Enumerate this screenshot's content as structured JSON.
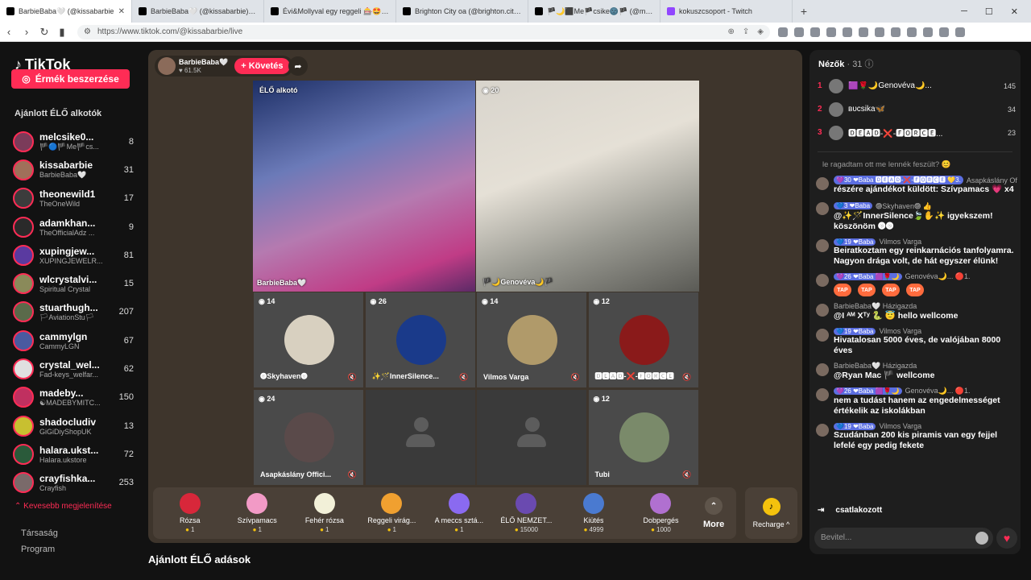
{
  "browser": {
    "tabs": [
      {
        "title": "BarbieBaba🤍 (@kissabarbie"
      },
      {
        "title": "BarbieBaba🤍 (@kissabarbie) ÉLŐ"
      },
      {
        "title": "Évi&Mollyval egy reggeli 🎰🤩 (@m"
      },
      {
        "title": "Brighton City oa (@brighton.city) ÉLŐ"
      },
      {
        "title": "🏴🌙⬛Me🏴csike🌚🏴 (@melc"
      },
      {
        "title": "kokuszcsoport - Twitch"
      }
    ],
    "url": "https://www.tiktok.com/@kissabarbie/live"
  },
  "sidebar": {
    "logo": "TikTok",
    "coins_button": "Érmék beszerzése",
    "section_title": "Ajánlott ÉLŐ alkotók",
    "creators": [
      {
        "name": "melcsike0...",
        "sub": "🏴🔵🏴Me🏴cs...",
        "count": "8",
        "color": "#7b3b5a"
      },
      {
        "name": "kissabarbie",
        "sub": "BarbieBaba🤍",
        "count": "31",
        "color": "#a0705a"
      },
      {
        "name": "theonewild1",
        "sub": "TheOneWild",
        "count": "17",
        "color": "#3c3c3c"
      },
      {
        "name": "adamkhan...",
        "sub": "TheOfficialAdz ...",
        "count": "9",
        "color": "#2a2a2a"
      },
      {
        "name": "xupingjew...",
        "sub": "XUPINGJEWELR...",
        "count": "81",
        "color": "#5a3aa0"
      },
      {
        "name": "wlcrystalvi...",
        "sub": "Spiritual Crystal",
        "count": "15",
        "color": "#8a8a5a"
      },
      {
        "name": "stuarthugh...",
        "sub": "🏳AviationStu🏳",
        "count": "207",
        "color": "#5a6a4a"
      },
      {
        "name": "cammylgn",
        "sub": "CammyLGN",
        "count": "67",
        "color": "#4a5aa0"
      },
      {
        "name": "crystal_wel...",
        "sub": "Fad-keys_welfar...",
        "count": "62",
        "color": "#e0e0e0"
      },
      {
        "name": "madeby...",
        "sub": "☯MADEBYMITC...",
        "count": "150",
        "color": "#c03060"
      },
      {
        "name": "shadocludiv",
        "sub": "GiGiDiyShopUK",
        "count": "13",
        "color": "#c8c030"
      },
      {
        "name": "halara.ukst...",
        "sub": "Halara.ukstore",
        "count": "72",
        "color": "#2a5a3a"
      },
      {
        "name": "crayfishka...",
        "sub": "Crayfish",
        "count": "253",
        "color": "#7a6a6a"
      }
    ],
    "show_less": "Kevesebb megjelenítése",
    "footer": [
      "Társaság",
      "Program"
    ]
  },
  "stage": {
    "host_name": "BarbieBaba🤍",
    "host_likes": "61.5K",
    "follow": "+ Követés",
    "main_label": "ÉLŐ alkotó",
    "main_name": "BarbieBaba🤍",
    "guest_count": "20",
    "guest_name": "🏴🌙Genovéva🌙🏴",
    "cells": [
      {
        "count": "14",
        "name": "𖣐Skyhaven𖣐",
        "color": "#d8d0c0"
      },
      {
        "count": "26",
        "name": "✨🪄InnerSilence...",
        "color": "#1a3a8a"
      },
      {
        "count": "14",
        "name": "Vilmos Varga",
        "color": "#b09a6a"
      },
      {
        "count": "12",
        "name": "🅳🅴🅰🅳-❌-🅵🅾🆁🅲🅴",
        "color": "#8a1a1a"
      },
      {
        "count": "24",
        "name": "Asapkáslány Offici...",
        "color": "#5a4a4a"
      },
      {
        "count": "",
        "name": "",
        "color": ""
      },
      {
        "count": "",
        "name": "",
        "color": ""
      },
      {
        "count": "12",
        "name": "Tubi",
        "color": "#7a8a6a"
      }
    ],
    "gifts": [
      {
        "name": "Rózsa",
        "price": "1",
        "color": "#d8273a"
      },
      {
        "name": "Szívpamacs",
        "price": "1",
        "color": "#f29ac6"
      },
      {
        "name": "Fehér rózsa",
        "price": "1",
        "color": "#f2f0d8"
      },
      {
        "name": "Reggeli virág...",
        "price": "1",
        "color": "#f0a030"
      },
      {
        "name": "A meccs sztá...",
        "price": "1",
        "color": "#8a6af0"
      },
      {
        "name": "ÉLŐ NEMZET...",
        "price": "15000",
        "color": "#6a4ab0"
      },
      {
        "name": "Kiütés",
        "price": "4999",
        "color": "#4a7ad0"
      },
      {
        "name": "Dobpergés",
        "price": "1000",
        "color": "#b070d0"
      }
    ],
    "more": "More",
    "recharge": "Recharge ^",
    "recommended": "Ajánlott ÉLŐ adások"
  },
  "viewers": {
    "title": "Nézők",
    "count": "· 31",
    "top": [
      {
        "rank": "1",
        "name": "🟪🌹🌙Genovéva🌙...",
        "score": "145"
      },
      {
        "rank": "2",
        "name": "ʙᴜcsika🦋",
        "score": "34"
      },
      {
        "rank": "3",
        "name": "🅳🅴🅰🅳-❌-🅵🅾🆁🅲🅴...",
        "score": "23"
      }
    ]
  },
  "chat": {
    "partial": "le ragadtam ott me lennék feszült? 😊",
    "messages": [
      {
        "badges": "💜30 ❤Baba 🅳🅴🅰🅳-❌-🅵🅾🆁🅲🅴 💛3.",
        "user": "Asapkáslány Official...",
        "text": "részére ajándékot küldött: Szívpamacs 💗 x4"
      },
      {
        "badges": "💙3 ❤Baba",
        "user": "𖣐Skyhaven𖣐 👍",
        "text": "@✨🪄InnerSilence🍃✋✨ igyekszem! köszönöm 𖣐𖣐"
      },
      {
        "badges": "💙19 ❤Baba",
        "user": "Vilmos Varga",
        "text": "Beiratkoztam egy reinkarnációs tanfolyamra. Nagyon drága volt, de hát egyszer élünk!"
      },
      {
        "badges": "💜26 ❤Baba 🟪🌹🌙",
        "user": "Genovéva🌙... 🔴1.",
        "text": ""
      },
      {
        "badges": "",
        "user": "BarbieBaba🤍 Házigazda",
        "text": "@I ᴬᴹ Xᵀʸ 🐍 😇 hello wellcome"
      },
      {
        "badges": "💙19 ❤Baba",
        "user": "Vilmos Varga",
        "text": "Hivatalosan 5000 éves, de valójában 8000 éves"
      },
      {
        "badges": "",
        "user": "BarbieBaba🤍 Házigazda",
        "text": "@Ryan Mac 🏴 wellcome"
      },
      {
        "badges": "💜26 ❤Baba 🟪🌹🌙",
        "user": "Genovéva🌙... 🔴1.",
        "text": "nem a tudást hanem az engedelmességet értékelik az iskolákban"
      },
      {
        "badges": "💙19 ❤Baba",
        "user": "Vilmos Varga",
        "text": "Szudánban 200 kis piramis van egy fejjel lefelé egy pedig fekete"
      }
    ],
    "tap": "TAP",
    "joined": "csatlakozott",
    "input_placeholder": "Bevitel..."
  }
}
